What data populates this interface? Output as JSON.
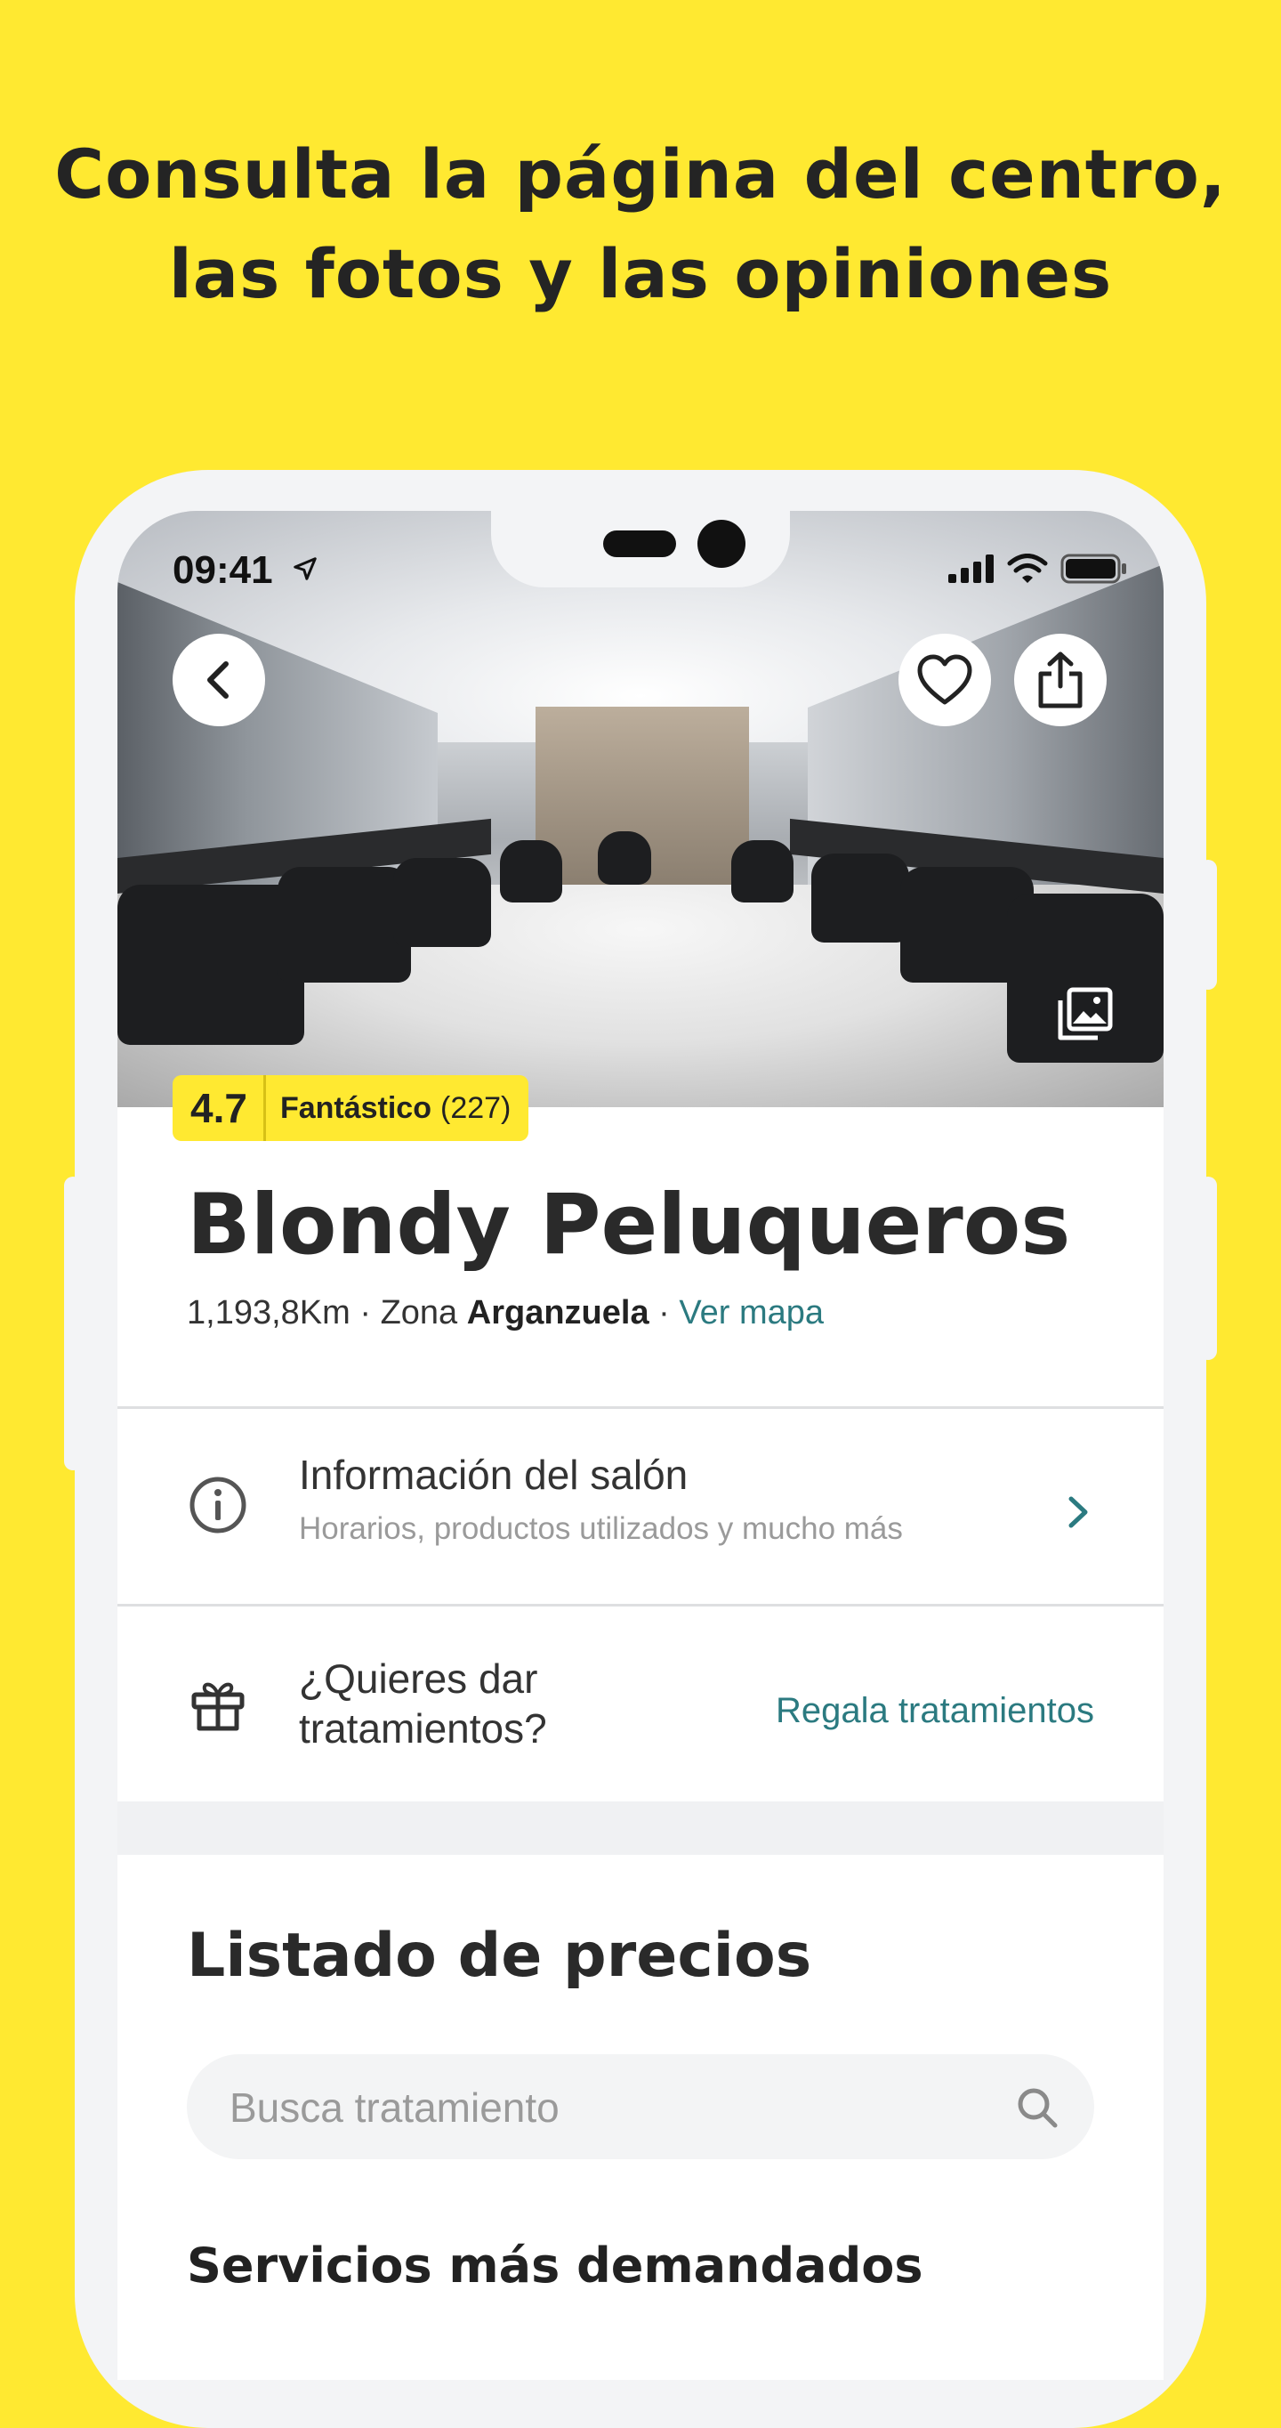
{
  "headline": {
    "line1": "Consulta la página del centro,",
    "line2": "las fotos y las opiniones"
  },
  "status_bar": {
    "time": "09:41"
  },
  "icons": {
    "back": "chevron-left-icon",
    "favorite": "heart-icon",
    "share": "share-icon",
    "gallery": "photo-gallery-icon",
    "info": "info-circle-icon",
    "gift": "gift-icon",
    "search": "search-icon"
  },
  "rating": {
    "score": "4.7",
    "label": "Fantástico",
    "count": "(227)"
  },
  "salon": {
    "name": "Blondy Peluqueros",
    "distance": "1,193,8Km",
    "zone_prefix": "Zona",
    "zone_name": "Arganzuela",
    "map_link": "Ver mapa"
  },
  "info_row": {
    "title": "Información del salón",
    "subtitle": "Horarios, productos utilizados y mucho más"
  },
  "gift_row": {
    "title": "¿Quieres dar tratamientos?",
    "link": "Regala tratamientos"
  },
  "prices": {
    "title": "Listado de precios",
    "search_placeholder": "Busca tratamiento",
    "popular_title": "Servicios más demandados"
  },
  "colors": {
    "background": "#ffe931",
    "accent_link": "#2b7a80",
    "rating_badge": "#ffe931"
  }
}
